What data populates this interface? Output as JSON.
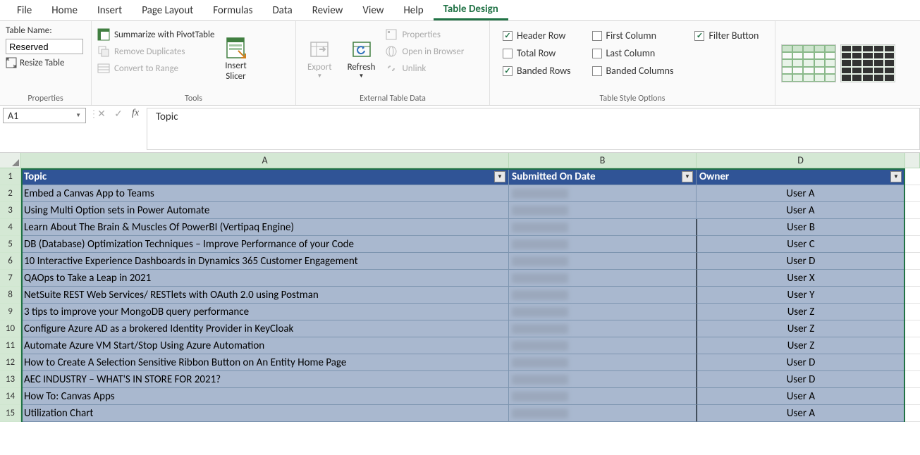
{
  "tabs": [
    "File",
    "Home",
    "Insert",
    "Page Layout",
    "Formulas",
    "Data",
    "Review",
    "View",
    "Help",
    "Table Design"
  ],
  "activeTab": "Table Design",
  "properties": {
    "label": "Table Name:",
    "value": "Reserved",
    "resize": "Resize Table",
    "groupLabel": "Properties"
  },
  "tools": {
    "pivot": "Summarize with PivotTable",
    "dup": "Remove Duplicates",
    "convert": "Convert to Range",
    "slicer": "Insert\nSlicer",
    "slicer1": "Insert",
    "slicer2": "Slicer",
    "groupLabel": "Tools"
  },
  "external": {
    "export": "Export",
    "refresh": "Refresh",
    "props": "Properties",
    "browser": "Open in Browser",
    "unlink": "Unlink",
    "groupLabel": "External Table Data"
  },
  "styleOptions": {
    "headerRow": "Header Row",
    "totalRow": "Total Row",
    "bandedRows": "Banded Rows",
    "firstCol": "First Column",
    "lastCol": "Last Column",
    "bandedCols": "Banded Columns",
    "filterBtn": "Filter Button",
    "groupLabel": "Table Style Options"
  },
  "nameBox": "A1",
  "formula": "Topic",
  "columns": [
    "A",
    "B",
    "D"
  ],
  "tableHeaders": {
    "topic": "Topic",
    "submitted": "Submitted On Date",
    "owner": "Owner"
  },
  "rows": [
    {
      "n": "1"
    },
    {
      "n": "2",
      "topic": "Embed a Canvas App to Teams",
      "owner": "User A",
      "split": false
    },
    {
      "n": "3",
      "topic": "Using Multi Option sets in Power Automate",
      "owner": "User A",
      "split": false
    },
    {
      "n": "4",
      "topic": "Learn About The Brain & Muscles Of PowerBI (Vertipaq Engine)",
      "owner": "User B",
      "split": true
    },
    {
      "n": "5",
      "topic": "DB (Database) Optimization Techniques – Improve Performance of your Code",
      "owner": "User C",
      "split": true
    },
    {
      "n": "6",
      "topic": "10 Interactive Experience Dashboards in Dynamics 365 Customer Engagement",
      "owner": "User D",
      "split": true
    },
    {
      "n": "7",
      "topic": "QAOps to Take a Leap in 2021",
      "owner": "User X",
      "split": true
    },
    {
      "n": "8",
      "topic": "NetSuite REST Web Services/ RESTlets with OAuth 2.0 using Postman",
      "owner": "User Y",
      "split": true
    },
    {
      "n": "9",
      "topic": "3 tips to improve your MongoDB query performance",
      "owner": "User Z",
      "split": true
    },
    {
      "n": "10",
      "topic": "Configure Azure AD as a brokered Identity Provider in KeyCloak",
      "owner": "User Z",
      "split": true
    },
    {
      "n": "11",
      "topic": "Automate Azure VM Start/Stop Using Azure Automation",
      "owner": "User Z",
      "split": true
    },
    {
      "n": "12",
      "topic": "How to Create A Selection Sensitive Ribbon Button on An Entity Home Page",
      "owner": "User D",
      "split": true
    },
    {
      "n": "13",
      "topic": "AEC INDUSTRY – WHAT'S IN STORE FOR 2021?",
      "owner": "User D",
      "split": true
    },
    {
      "n": "14",
      "topic": "How To: Canvas Apps",
      "owner": "User A",
      "split": true
    },
    {
      "n": "15",
      "topic": "Utilization Chart",
      "owner": "User A",
      "split": true
    }
  ]
}
